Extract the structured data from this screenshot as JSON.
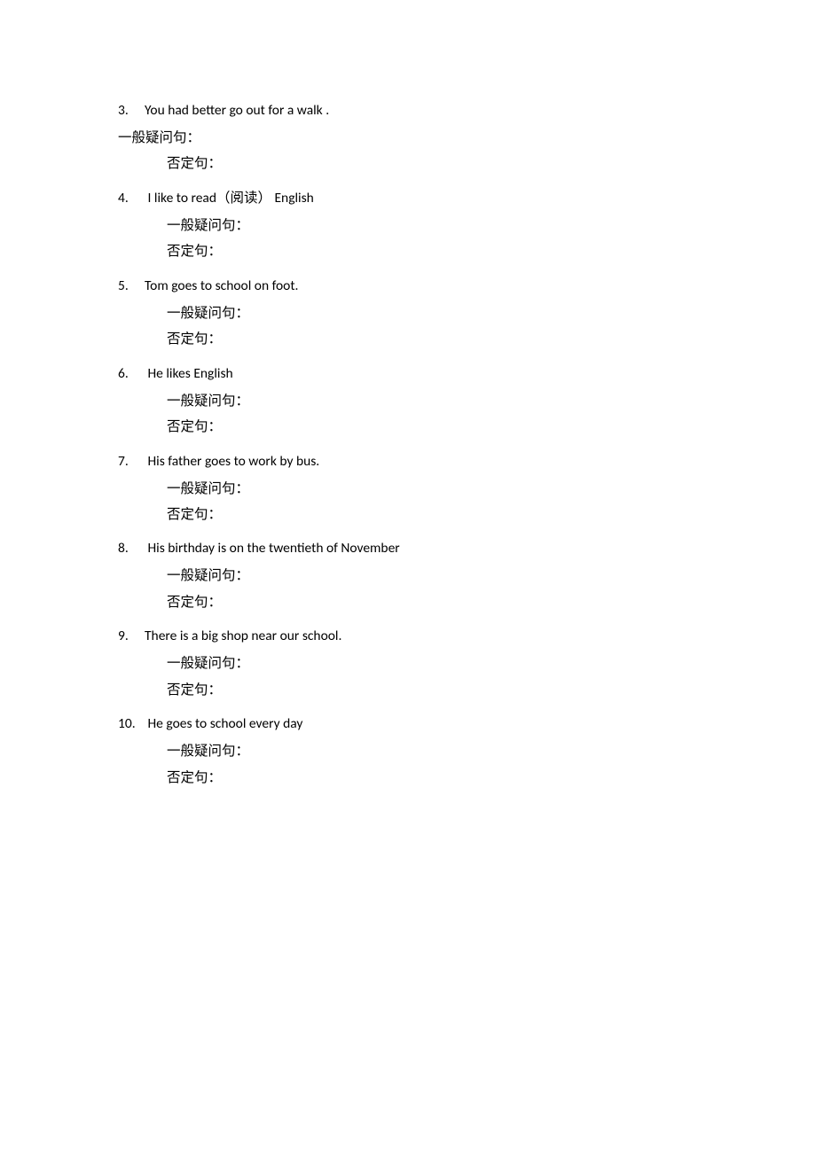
{
  "questions": [
    {
      "num": "3.",
      "text": "You had better go out for a walk .",
      "sub1": "一般疑问句：",
      "sub2": "否定句：",
      "outdentFirst": true
    },
    {
      "num": "4.",
      "text": " I like to read（阅读） English",
      "sub1": "一般疑问句：",
      "sub2": "否定句：",
      "outdentFirst": false
    },
    {
      "num": "5.",
      "text": "Tom goes to school on foot.",
      "sub1": "一般疑问句：",
      "sub2": "否定句：",
      "outdentFirst": false
    },
    {
      "num": "6.",
      "text": " He likes English",
      "sub1": "一般疑问句：",
      "sub2": "否定句：",
      "outdentFirst": false
    },
    {
      "num": "7.",
      "text": " His father goes to work by bus.",
      "sub1": "一般疑问句：",
      "sub2": "否定句：",
      "outdentFirst": false
    },
    {
      "num": "8.",
      "text": " His birthday is on the twentieth of November",
      "sub1": "一般疑问句：",
      "sub2": "否定句：",
      "outdentFirst": false
    },
    {
      "num": "9.",
      "text": "There is a big shop near our school.",
      "sub1": "一般疑问句：",
      "sub2": "否定句：",
      "outdentFirst": false
    },
    {
      "num": "10.",
      "text": " He goes to school every day",
      "sub1": "一般疑问句：",
      "sub2": "否定句：",
      "outdentFirst": false
    }
  ]
}
